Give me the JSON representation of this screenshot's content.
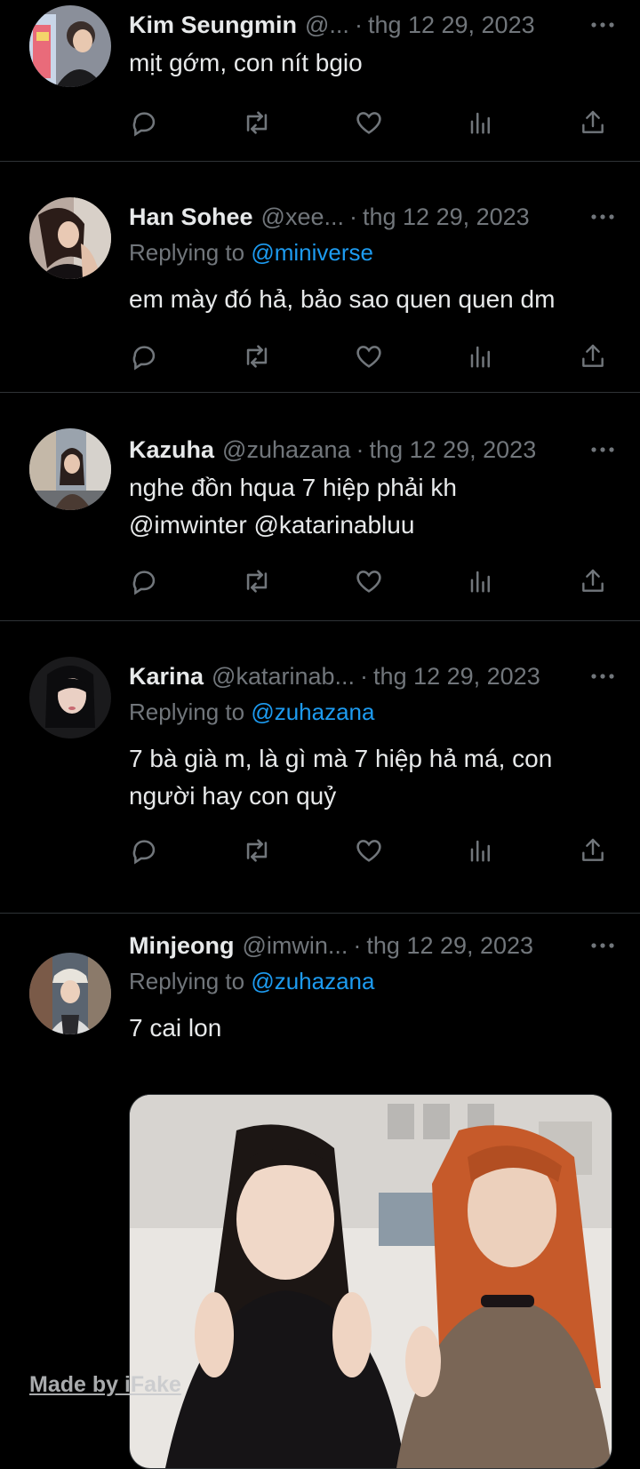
{
  "tweets": [
    {
      "name": "Kim Seungmin",
      "handle": "@...",
      "separator": "·",
      "date": "thg 12 29, 2023",
      "replying_label": "",
      "replying_to": "",
      "text": "mịt gớm, con nít bgio",
      "mentions": ""
    },
    {
      "name": "Han Sohee",
      "handle": "@xee...",
      "separator": "·",
      "date": "thg 12 29, 2023",
      "replying_label": "Replying to",
      "replying_to": "@miniverse",
      "text": "em mày đó hả, bảo sao quen quen dm",
      "mentions": ""
    },
    {
      "name": "Kazuha",
      "handle": "@zuhazana",
      "separator": "·",
      "date": "thg 12 29, 2023",
      "replying_label": "",
      "replying_to": "",
      "text": "nghe đồn hqua 7 hiệp phải kh",
      "mentions": "@imwinter @katarinabluu"
    },
    {
      "name": "Karina",
      "handle": "@katarinab...",
      "separator": "·",
      "date": "thg 12 29, 2023",
      "replying_label": "Replying to",
      "replying_to": "@zuhazana",
      "text": "7 bà già m, là gì mà 7 hiệp hả má, con người hay con quỷ",
      "mentions": ""
    },
    {
      "name": "Minjeong",
      "handle": "@imwin...",
      "separator": "·",
      "date": "thg 12 29, 2023",
      "replying_label": "Replying to",
      "replying_to": "@zuhazana",
      "text": "7 cai lon",
      "mentions": ""
    }
  ],
  "watermark": "Made by iFake",
  "icons": {
    "reply": "reply-icon",
    "retweet": "retweet-icon",
    "like": "heart-icon",
    "views": "views-icon",
    "share": "share-icon",
    "more": "more-icon"
  },
  "colors": {
    "background": "#000000",
    "text": "#e7e9ea",
    "muted": "#71767b",
    "link": "#1d9bf0",
    "divider": "#2f3336"
  }
}
